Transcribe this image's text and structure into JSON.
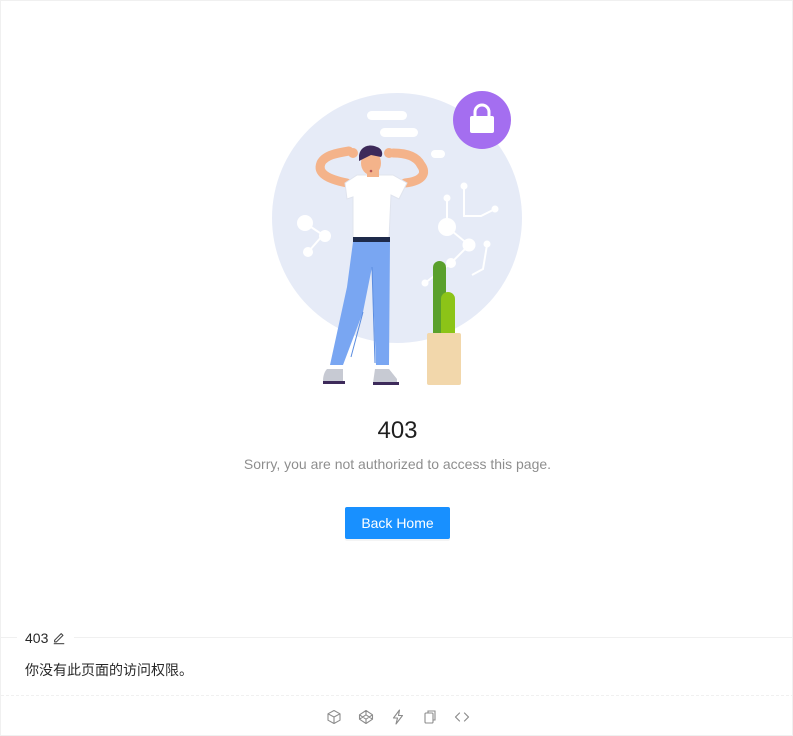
{
  "result": {
    "status_code": "403",
    "subtitle": "Sorry, you are not authorized to access this page.",
    "action_label": "Back Home"
  },
  "demo_meta": {
    "title": "403",
    "description": "你没有此页面的访问权限。"
  },
  "icons": {
    "illustration": "person-locked-out-illustration",
    "lock": "lock-icon",
    "edit": "edit-icon",
    "codesandbox": "codesandbox-icon",
    "codepen": "codepen-icon",
    "stackblitz": "lightning-icon",
    "copy": "copy-icon",
    "code": "code-icon"
  },
  "colors": {
    "primary": "#1890ff",
    "lock_badge": "#a46ef0",
    "illustration_bg": "#e6ebf7"
  }
}
